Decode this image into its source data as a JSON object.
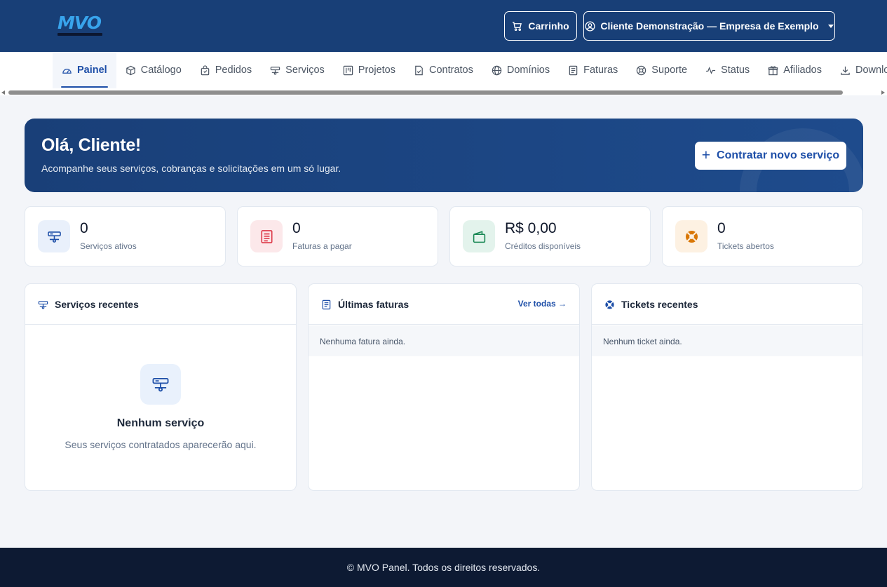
{
  "header": {
    "logo_text": "MVO",
    "cart_label": "Carrinho",
    "user_label": "Cliente Demonstração — Empresa de Exemplo"
  },
  "nav": {
    "items": [
      {
        "label": "Painel",
        "icon": "gauge-icon",
        "active": true
      },
      {
        "label": "Catálogo",
        "icon": "box-icon"
      },
      {
        "label": "Pedidos",
        "icon": "bag-icon"
      },
      {
        "label": "Serviços",
        "icon": "server-icon"
      },
      {
        "label": "Projetos",
        "icon": "kanban-icon"
      },
      {
        "label": "Contratos",
        "icon": "file-check-icon"
      },
      {
        "label": "Domínios",
        "icon": "globe-icon"
      },
      {
        "label": "Faturas",
        "icon": "receipt-icon"
      },
      {
        "label": "Suporte",
        "icon": "life-ring-icon"
      },
      {
        "label": "Status",
        "icon": "pulse-icon"
      },
      {
        "label": "Afiliados",
        "icon": "gift-icon"
      },
      {
        "label": "Downloads",
        "icon": "download-icon"
      }
    ]
  },
  "hero": {
    "title": "Olá, Cliente!",
    "subtitle": "Acompanhe seus serviços, cobranças e solicitações em um só lugar.",
    "cta_label": "Contratar novo serviço"
  },
  "stats": [
    {
      "value": "0",
      "label": "Serviços ativos",
      "icon": "server-icon",
      "color": "#1e4fa8",
      "bg": "#e9f0fb"
    },
    {
      "value": "0",
      "label": "Faturas a pagar",
      "icon": "receipt-icon",
      "color": "#dc3545",
      "bg": "#fce8ea"
    },
    {
      "value": "R$ 0,00",
      "label": "Créditos disponíveis",
      "icon": "wallet-icon",
      "color": "#198754",
      "bg": "#e3f3ec"
    },
    {
      "value": "0",
      "label": "Tickets abertos",
      "icon": "life-ring-icon",
      "color": "#d97706",
      "bg": "#fdf1e2"
    }
  ],
  "panels": {
    "services": {
      "title": "Serviços recentes",
      "empty_title": "Nenhum serviço",
      "empty_sub": "Seus serviços contratados aparecerão aqui."
    },
    "invoices": {
      "title": "Últimas faturas",
      "link": "Ver todas →",
      "empty": "Nenhuma fatura ainda."
    },
    "tickets": {
      "title": "Tickets recentes",
      "empty": "Nenhum ticket ainda."
    }
  },
  "footer": {
    "text": "© MVO Panel. Todos os direitos reservados."
  }
}
